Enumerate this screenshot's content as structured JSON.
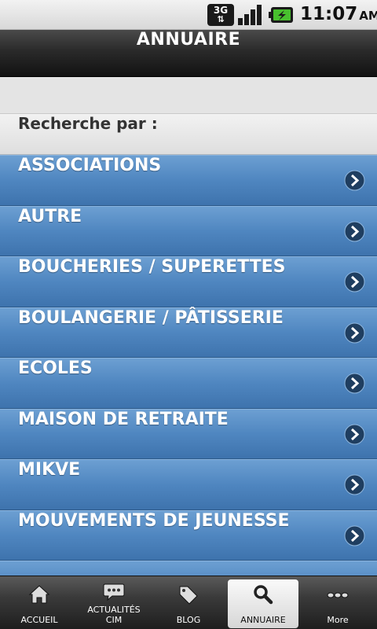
{
  "status_bar": {
    "network": "3G",
    "time": "11:07",
    "ampm": "AM"
  },
  "title": "ANNUAIRE",
  "section_header": "Recherche par :",
  "list": [
    {
      "label": "ASSOCIATIONS"
    },
    {
      "label": "AUTRE"
    },
    {
      "label": "BOUCHERIES / SUPERETTES"
    },
    {
      "label": "BOULANGERIE / PÂTISSERIE"
    },
    {
      "label": "ECOLES"
    },
    {
      "label": "MAISON DE RETRAITE"
    },
    {
      "label": "MIKVE"
    },
    {
      "label": "MOUVEMENTS DE JEUNESSE"
    },
    {
      "label": ""
    }
  ],
  "tabs": [
    {
      "label": "ACCUEIL",
      "icon": "home-icon"
    },
    {
      "label": "ACTUALITÉS\nCIM",
      "icon": "chat-bubble-icon"
    },
    {
      "label": "BLOG",
      "icon": "tag-icon"
    },
    {
      "label": "ANNUAIRE",
      "icon": "search-icon",
      "active": true
    },
    {
      "label": "More",
      "icon": "more-icon"
    }
  ],
  "colors": {
    "list_row": "#4f86c0",
    "title_bar": "#2a2a2a",
    "tab_bar": "#3a3a3a"
  }
}
